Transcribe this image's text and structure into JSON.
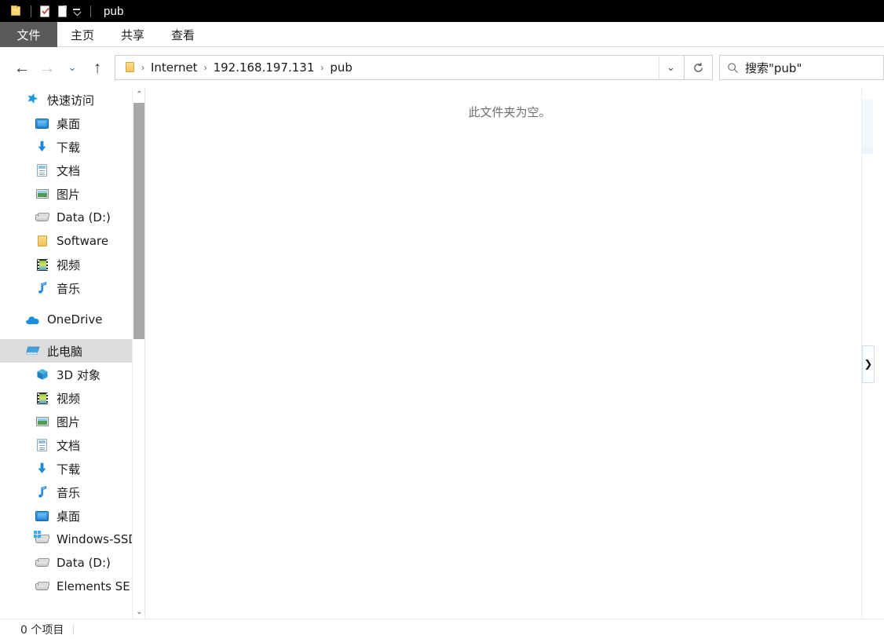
{
  "window": {
    "title": "pub",
    "quick_access_toolbar": [
      {
        "name": "folder-icon",
        "label": "属性"
      },
      {
        "name": "properties-icon",
        "label": "属性"
      },
      {
        "name": "new-folder-icon",
        "label": "新建文件夹"
      },
      {
        "name": "chevron-down-icon",
        "label": "自定义快速访问工具栏"
      }
    ]
  },
  "ribbon": {
    "tabs": [
      {
        "id": "file",
        "label": "文件",
        "active": true
      },
      {
        "id": "home",
        "label": "主页",
        "active": false
      },
      {
        "id": "share",
        "label": "共享",
        "active": false
      },
      {
        "id": "view",
        "label": "查看",
        "active": false
      }
    ]
  },
  "navbar": {
    "back_label": "←",
    "forward_label": "→",
    "history_label": "⌄",
    "up_label": "↑",
    "breadcrumbs": [
      "Internet",
      "192.168.197.131",
      "pub"
    ],
    "breadcrumb_separator": "›",
    "address_caret": "⌄",
    "refresh_label": "↻",
    "search": {
      "placeholder": "搜索\"pub\"",
      "value": "搜索\"pub\"",
      "icon": "search-icon"
    }
  },
  "sidebar": {
    "groups": [
      {
        "id": "quick-access",
        "label": "快速访问",
        "icon": "star-icon",
        "items": [
          {
            "label": "桌面",
            "icon": "desktop-icon",
            "pinned": true
          },
          {
            "label": "下载",
            "icon": "download-icon",
            "pinned": true
          },
          {
            "label": "文档",
            "icon": "document-icon",
            "pinned": true
          },
          {
            "label": "图片",
            "icon": "pictures-icon",
            "pinned": true
          },
          {
            "label": "Data (D:)",
            "icon": "drive-icon",
            "pinned": false
          },
          {
            "label": "Software",
            "icon": "folder-icon",
            "pinned": false
          },
          {
            "label": "视频",
            "icon": "video-icon",
            "pinned": false
          },
          {
            "label": "音乐",
            "icon": "music-icon",
            "pinned": false
          }
        ]
      },
      {
        "id": "onedrive",
        "label": "OneDrive",
        "icon": "onedrive-icon",
        "items": []
      },
      {
        "id": "this-pc",
        "label": "此电脑",
        "icon": "this-pc-icon",
        "selected": true,
        "items": [
          {
            "label": "3D 对象",
            "icon": "3d-objects-icon"
          },
          {
            "label": "视频",
            "icon": "video-icon"
          },
          {
            "label": "图片",
            "icon": "pictures-icon"
          },
          {
            "label": "文档",
            "icon": "document-icon"
          },
          {
            "label": "下载",
            "icon": "download-icon"
          },
          {
            "label": "音乐",
            "icon": "music-icon"
          },
          {
            "label": "桌面",
            "icon": "desktop-icon"
          },
          {
            "label": "Windows-SSD (",
            "icon": "windows-drive-icon"
          },
          {
            "label": "Data (D:)",
            "icon": "drive-icon"
          },
          {
            "label": "Elements SE (E:",
            "icon": "drive-icon"
          }
        ]
      }
    ],
    "scroll": {
      "up_arrow": "⌃",
      "down_arrow": "⌄"
    }
  },
  "main": {
    "empty_message": "此文件夹为空。",
    "edge_chevron": "❯"
  },
  "statusbar": {
    "item_count": "0 个项目"
  },
  "colors": {
    "titlebar_bg": "#000000",
    "file_tab_bg": "#5a5a5a",
    "accent": "#0078d7",
    "selection_bg": "#dcdcdc",
    "folder_yellow": "#f0c255"
  }
}
